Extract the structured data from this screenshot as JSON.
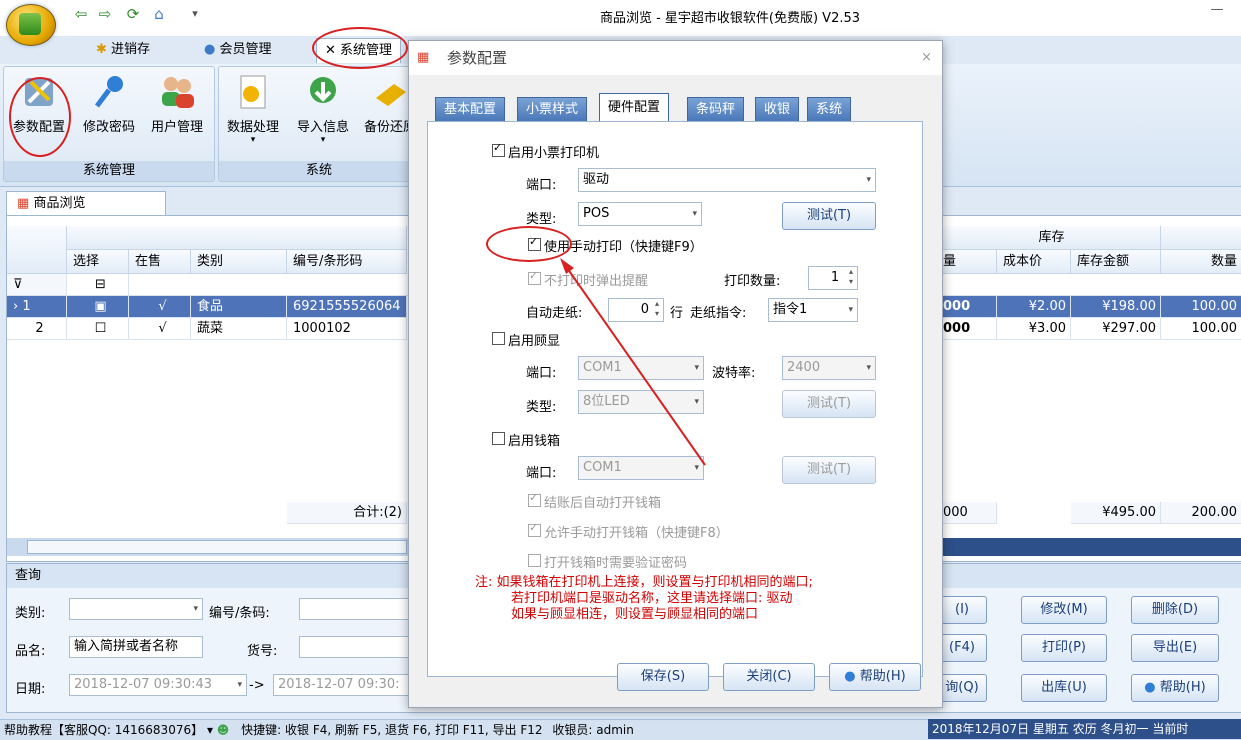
{
  "window": {
    "title": "商品浏览 - 星宇超市收银软件(免费版) V2.53"
  },
  "ribbon": {
    "tabs": [
      {
        "label": "进销存"
      },
      {
        "label": "会员管理"
      },
      {
        "label": "系统管理"
      }
    ],
    "buttons": [
      {
        "label": "参数配置"
      },
      {
        "label": "修改密码"
      },
      {
        "label": "用户管理"
      },
      {
        "label": "数据处理"
      },
      {
        "label": "导入信息"
      },
      {
        "label": "备份还原"
      }
    ],
    "groups": [
      {
        "label": "系统管理"
      },
      {
        "label": "系统"
      }
    ]
  },
  "doc_tab": {
    "label": "商品浏览"
  },
  "grid": {
    "group_header": "库存",
    "columns": [
      "选择",
      "在售",
      "类别",
      "编号/条形码",
      "量",
      "成本价",
      "库存金额",
      "数量"
    ],
    "rows": [
      {
        "index": "1",
        "onsale": "√",
        "category": "食品",
        "code": "6921555526064",
        "qty": "000",
        "cost": "¥2.00",
        "amount": "¥198.00",
        "count": "100.00"
      },
      {
        "index": "2",
        "onsale": "√",
        "category": "蔬菜",
        "code": "1000102",
        "qty": "000",
        "cost": "¥3.00",
        "amount": "¥297.00",
        "count": "100.00"
      }
    ],
    "footer": {
      "total_label": "合计:(2)",
      "qty": "000",
      "amount": "¥495.00",
      "count": "200.00"
    }
  },
  "query": {
    "title": "查询",
    "category_label": "类别:",
    "code_label": "编号/条码:",
    "name_label": "品名:",
    "name_value": "输入简拼或者名称",
    "item_label": "货号:",
    "date_label": "日期:",
    "date_from": "2018-12-07 09:30:43",
    "date_sep": "->",
    "date_to": "2018-12-07 09:30:",
    "buttons": {
      "add": "(I)",
      "modify": "修改(M)",
      "delete": "删除(D)",
      "f4": "(F4)",
      "print": "打印(P)",
      "export": "导出(E)",
      "query": "询(Q)",
      "outstock": "出库(U)",
      "help": "帮助(H)"
    }
  },
  "status": {
    "left": "帮助教程【客服QQ: 1416683076】",
    "shortcuts": "快捷键: 收银 F4, 刷新 F5, 退货 F6, 打印 F11, 导出 F12",
    "cashier": "收银员: admin",
    "date": "2018年12月07日 星期五 农历 冬月初一 当前时"
  },
  "dialog": {
    "title": "参数配置",
    "tabs": [
      "基本配置",
      "小票样式",
      "硬件配置",
      "条码秤",
      "收银",
      "系统"
    ],
    "printer": {
      "enable_label": "启用小票打印机",
      "port_label": "端口:",
      "port_value": "驱动",
      "type_label": "类型:",
      "type_value": "POS",
      "test_label": "测试(T)",
      "manual_label": "使用手动打印（快捷键F9）",
      "popup_label": "不打印时弹出提醒",
      "count_label": "打印数量:",
      "count_value": "1",
      "feed_label": "自动走纸:",
      "feed_value": "0",
      "feed_unit": "行",
      "cmd_label": "走纸指令:",
      "cmd_value": "指令1"
    },
    "display": {
      "enable_label": "启用顾显",
      "port_label": "端口:",
      "port_value": "COM1",
      "baud_label": "波特率:",
      "baud_value": "2400",
      "type_label": "类型:",
      "type_value": "8位LED",
      "test_label": "测试(T)"
    },
    "drawer": {
      "enable_label": "启用钱箱",
      "port_label": "端口:",
      "port_value": "COM1",
      "test_label": "测试(T)",
      "opt1": "结账后自动打开钱箱",
      "opt2": "允许手动打开钱箱（快捷键F8）",
      "opt3": "打开钱箱时需要验证密码"
    },
    "note": [
      "注: 如果钱箱在打印机上连接，则设置与打印机相同的端口;",
      "若打印机端口是驱动名称，这里请选择端口: 驱动",
      "如果与顾显相连，则设置与顾显相同的端口"
    ],
    "buttons": {
      "save": "保存(S)",
      "close": "关闭(C)",
      "help": "帮助(H)"
    }
  },
  "colors": {
    "annotation": "#d92020",
    "accent": "#4f73b8"
  }
}
